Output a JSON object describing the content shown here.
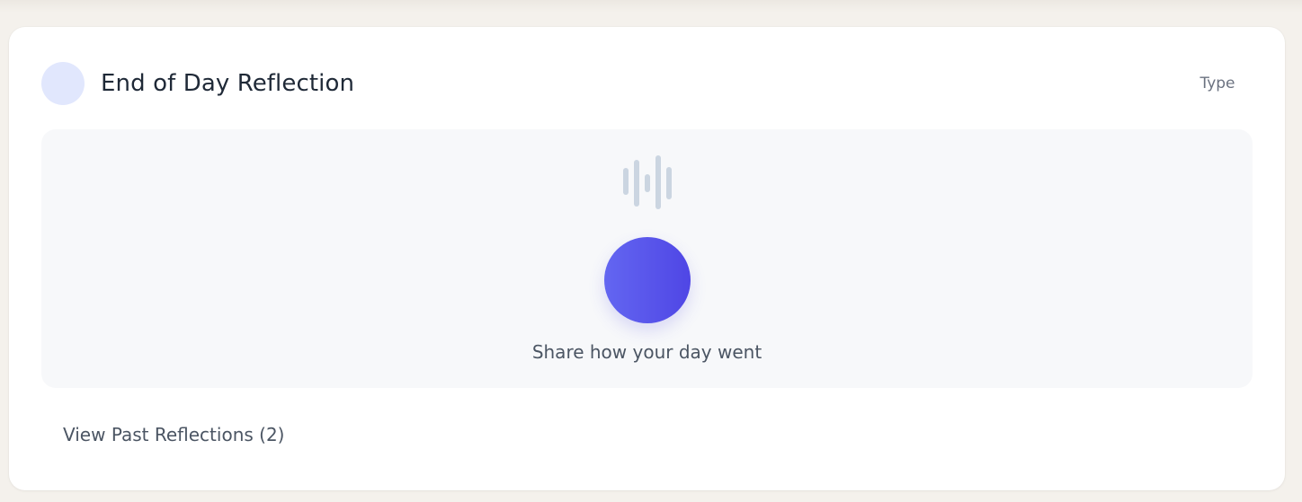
{
  "reflection_card": {
    "title": "End of Day Reflection",
    "type_button_label": "Type",
    "recorder": {
      "icon": "waveform-icon",
      "record_button_icon": "microphone-record-button",
      "prompt": "Share how your day went"
    },
    "past_link_label": "View Past Reflections (2)"
  },
  "colors": {
    "accent_start": "#6366f1",
    "accent_end": "#4f46e5",
    "header_icon_bg": "#e1e7fd",
    "waveform": "#cbd5e1",
    "recorder_bg": "#f7f8fa"
  }
}
